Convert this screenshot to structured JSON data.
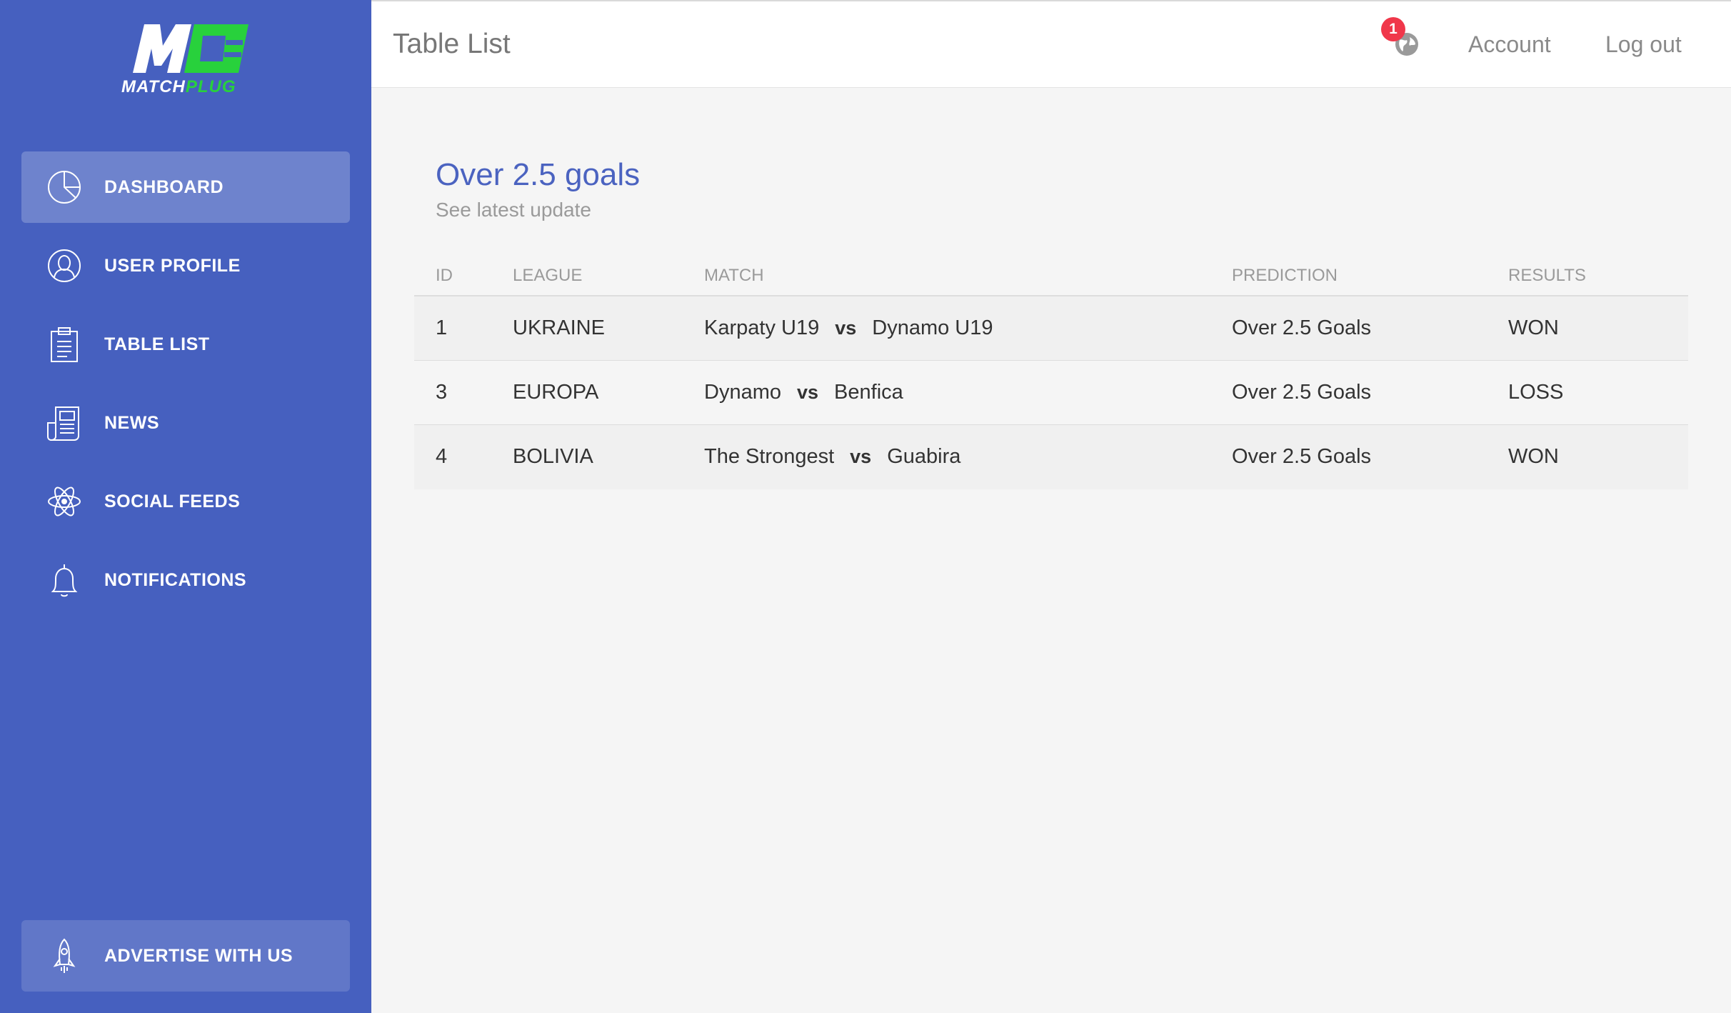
{
  "brand": {
    "logo_text_white": "MATCH",
    "logo_text_green": "PLUG",
    "colors": {
      "sidebar": "#4660bf",
      "accent_green": "#28d13c",
      "title_blue": "#4b63c0",
      "badge_red": "#f0374a"
    }
  },
  "sidebar": {
    "items": [
      {
        "label": "DASHBOARD",
        "icon": "pie-chart-icon",
        "active": true
      },
      {
        "label": "USER PROFILE",
        "icon": "user-icon",
        "active": false
      },
      {
        "label": "TABLE LIST",
        "icon": "clipboard-icon",
        "active": false
      },
      {
        "label": "NEWS",
        "icon": "newspaper-icon",
        "active": false
      },
      {
        "label": "SOCIAL FEEDS",
        "icon": "atom-icon",
        "active": false
      },
      {
        "label": "NOTIFICATIONS",
        "icon": "bell-icon",
        "active": false
      }
    ],
    "footer": {
      "label": "ADVERTISE WITH US",
      "icon": "rocket-icon"
    }
  },
  "header": {
    "title": "Table List",
    "notification_count": "1",
    "account_label": "Account",
    "logout_label": "Log out"
  },
  "card": {
    "title": "Over 2.5 goals",
    "subtitle": "See latest update"
  },
  "table": {
    "columns": [
      "ID",
      "LEAGUE",
      "MATCH",
      "PREDICTION",
      "RESULTS"
    ],
    "vs_label": "vs",
    "rows": [
      {
        "id": "1",
        "league": "UKRAINE",
        "home": "Karpaty U19",
        "away": "Dynamo U19",
        "prediction": "Over 2.5 Goals",
        "result": "WON"
      },
      {
        "id": "3",
        "league": "EUROPA",
        "home": "Dynamo",
        "away": "Benfica",
        "prediction": "Over 2.5 Goals",
        "result": "LOSS"
      },
      {
        "id": "4",
        "league": "BOLIVIA",
        "home": "The Strongest",
        "away": "Guabira",
        "prediction": "Over 2.5 Goals",
        "result": "WON"
      }
    ]
  }
}
